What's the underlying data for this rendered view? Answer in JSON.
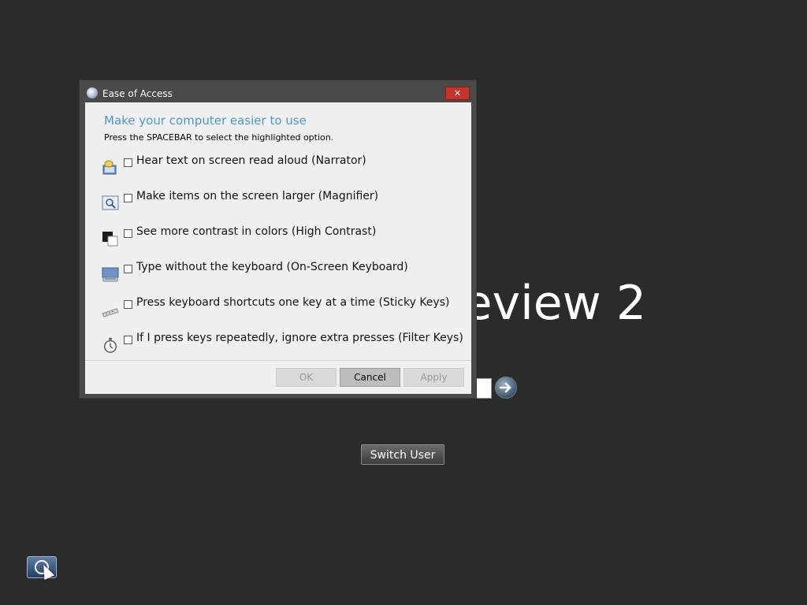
{
  "background": {
    "title_partial": "eview 2",
    "switch_user_label": "Switch User"
  },
  "dialog": {
    "title": "Ease of Access",
    "close_glyph": "✕",
    "heading": "Make your computer easier to use",
    "instruction": "Press the SPACEBAR to select the highlighted option.",
    "options": [
      {
        "label": "Hear text on screen read aloud (Narrator)",
        "icon": "narrator-icon",
        "checked": false
      },
      {
        "label": "Make items on the screen larger (Magnifier)",
        "icon": "magnifier-icon",
        "checked": false
      },
      {
        "label": "See more contrast in colors (High Contrast)",
        "icon": "high-contrast-icon",
        "checked": false
      },
      {
        "label": "Type without the keyboard (On-Screen Keyboard)",
        "icon": "on-screen-keyboard-icon",
        "checked": false
      },
      {
        "label": "Press keyboard shortcuts one key at a time (Sticky Keys)",
        "icon": "sticky-keys-icon",
        "checked": false
      },
      {
        "label": "If I press keys repeatedly, ignore extra presses (Filter Keys)",
        "icon": "filter-keys-icon",
        "checked": false
      }
    ],
    "buttons": {
      "ok": "OK",
      "cancel": "Cancel",
      "apply": "Apply"
    }
  },
  "colors": {
    "background": "#2b2b2b",
    "accent_heading": "#4d9ac9",
    "close_button": "#c2332a"
  }
}
